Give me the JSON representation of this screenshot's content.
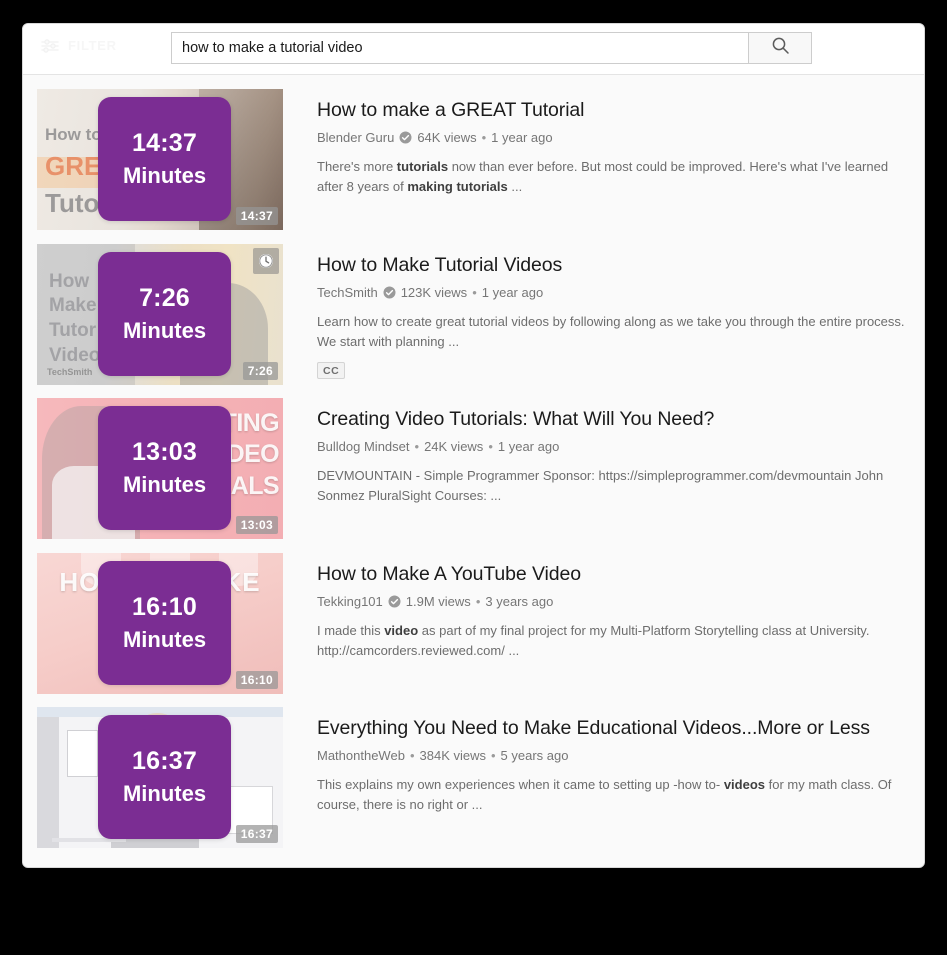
{
  "header": {
    "filter_label": "FILTER",
    "filter_icon": "tune-filter-icon",
    "search_value": "how to make a tutorial video",
    "search_placeholder": "Search",
    "search_icon": "search-icon"
  },
  "colors": {
    "overlay_purple": "#7B2D93",
    "page_background": "#000000",
    "panel_background": "#ffffff",
    "results_background": "#fafafa",
    "title_text": "#1b1b1b",
    "meta_text": "#767676"
  },
  "results": [
    {
      "overlay_time": "14:37",
      "overlay_unit": "Minutes",
      "duration": "14:37",
      "title": "How to make a GREAT Tutorial",
      "channel": "Blender Guru",
      "verified": true,
      "views": "64K views",
      "age": "1 year ago",
      "desc_1": "There's more ",
      "desc_b1": "tutorials",
      "desc_2": " now than ever before. But most could be improved. Here's what I've learned after 8 years of ",
      "desc_b2": "making tutorials",
      "desc_3": " ...",
      "cc": "",
      "watch_later": false,
      "thumb_caption": "How to m\nGREAT\nTutorial"
    },
    {
      "overlay_time": "7:26",
      "overlay_unit": "Minutes",
      "duration": "7:26",
      "title": "How to Make Tutorial Videos",
      "channel": "TechSmith",
      "verified": true,
      "views": "123K views",
      "age": "1 year ago",
      "desc_1": "Learn how to create great tutorial videos by following along as we take you through the entire process. We start with planning ...",
      "desc_b1": "",
      "desc_2": "",
      "desc_b2": "",
      "desc_3": "",
      "cc": "CC",
      "watch_later": true,
      "thumb_caption": "How\nMake\nTutor\nVideo"
    },
    {
      "overlay_time": "13:03",
      "overlay_unit": "Minutes",
      "duration": "13:03",
      "title": "Creating Video Tutorials: What Will You Need?",
      "channel": "Bulldog Mindset",
      "verified": false,
      "views": "24K views",
      "age": "1 year ago",
      "desc_1": "DEVMOUNTAIN - Simple Programmer Sponsor: https://simpleprogrammer.com/devmountain John Sonmez PluralSight Courses: ...",
      "desc_b1": "",
      "desc_2": "",
      "desc_b2": "",
      "desc_3": "",
      "cc": "",
      "watch_later": false,
      "thumb_caption": "CREATING\nVIDEO\nTUTORIALS"
    },
    {
      "overlay_time": "16:10",
      "overlay_unit": "Minutes",
      "duration": "16:10",
      "title": "How to Make A YouTube Video",
      "channel": "Tekking101",
      "verified": true,
      "views": "1.9M views",
      "age": "3 years ago",
      "desc_1": "I made this ",
      "desc_b1": "video",
      "desc_2": " as part of my final project for my Multi-Platform Storytelling class at University. http://camcorders.reviewed.com/ ...",
      "desc_b2": "",
      "desc_3": "",
      "cc": "",
      "watch_later": false,
      "thumb_caption": "HOW TO MAKE A\nVIDEO"
    },
    {
      "overlay_time": "16:37",
      "overlay_unit": "Minutes",
      "duration": "16:37",
      "title": "Everything You Need to Make Educational Videos...More or Less",
      "channel": "MathontheWeb",
      "verified": false,
      "views": "384K views",
      "age": "5 years ago",
      "desc_1": "This explains my own experiences when it came to setting up -how to- ",
      "desc_b1": "videos",
      "desc_2": " for my math class. Of course, there is no right or ...",
      "desc_b2": "",
      "desc_3": "",
      "cc": "",
      "watch_later": false,
      "thumb_caption": ""
    }
  ]
}
